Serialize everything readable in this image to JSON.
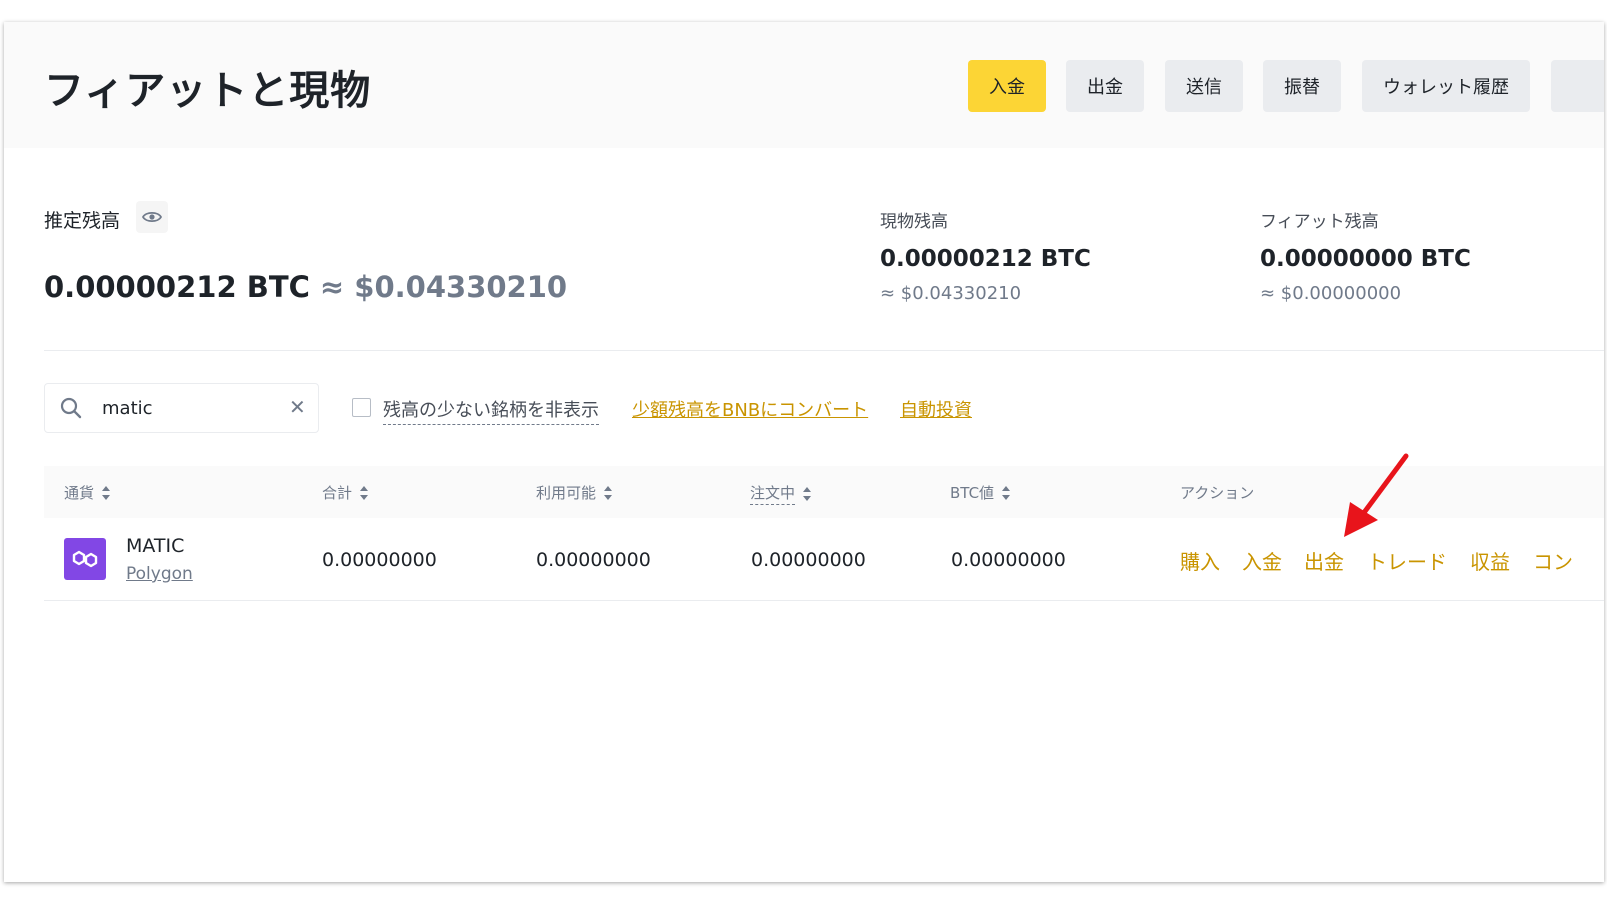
{
  "header": {
    "title": "フィアットと現物",
    "buttons": [
      "入金",
      "出金",
      "送信",
      "振替",
      "ウォレット履歴"
    ]
  },
  "balance": {
    "estimated_label": "推定残高",
    "estimated_btc": "0.00000212 BTC",
    "estimated_usd": "≈ $0.04330210",
    "spot_label": "現物残高",
    "spot_btc": "0.00000212 BTC",
    "spot_usd": "≈ $0.04330210",
    "fiat_label": "フィアット残高",
    "fiat_btc": "0.00000000 BTC",
    "fiat_usd": "≈ $0.00000000"
  },
  "filters": {
    "search_value": "matic",
    "hide_small_label": "残高の少ない銘柄を非表示",
    "convert_link": "少額残高をBNBにコンバート",
    "auto_invest_link": "自動投資"
  },
  "table": {
    "columns": [
      "通貨",
      "合計",
      "利用可能",
      "注文中",
      "BTC値",
      "アクション"
    ],
    "rows": [
      {
        "symbol": "MATIC",
        "name": "Polygon",
        "total": "0.00000000",
        "available": "0.00000000",
        "in_order": "0.00000000",
        "btc_value": "0.00000000",
        "actions": [
          "購入",
          "入金",
          "出金",
          "トレード",
          "収益",
          "コン"
        ]
      }
    ]
  },
  "colors": {
    "accent": "#fcd535",
    "link": "#c99400",
    "polygon": "#8247e5",
    "annotation_arrow": "#e8141b"
  }
}
